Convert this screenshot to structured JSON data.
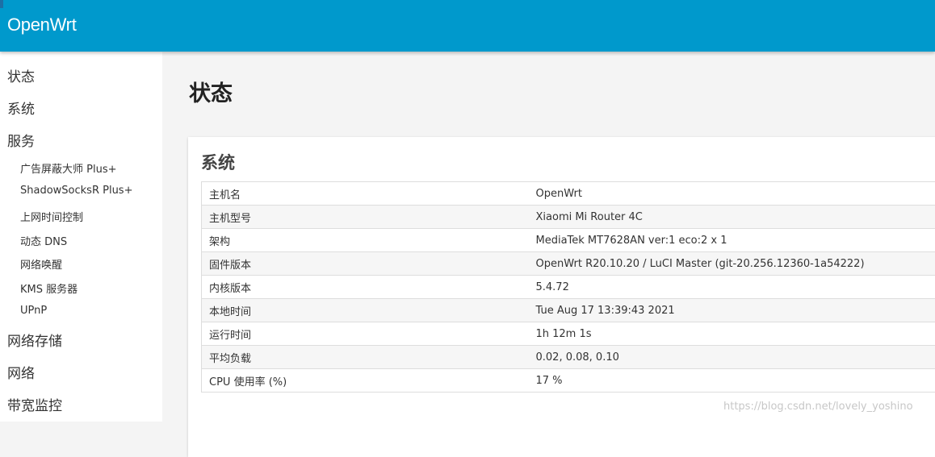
{
  "brand": "OpenWrt",
  "sidebar": {
    "top_items": [
      "状态",
      "系统",
      "服务"
    ],
    "services_subitems": [
      "广告屏蔽大师 Plus+",
      "ShadowSocksR Plus+",
      "上网时间控制",
      "动态 DNS",
      "网络唤醒",
      "KMS 服务器",
      "UPnP"
    ],
    "bottom_items": [
      "网络存储",
      "网络",
      "带宽监控"
    ]
  },
  "page": {
    "title": "状态"
  },
  "system_card": {
    "title": "系统",
    "rows": [
      {
        "label": "主机名",
        "value": "OpenWrt"
      },
      {
        "label": "主机型号",
        "value": "Xiaomi Mi Router 4C"
      },
      {
        "label": "架构",
        "value": "MediaTek MT7628AN ver:1 eco:2 x 1"
      },
      {
        "label": "固件版本",
        "value": "OpenWrt R20.10.20 / LuCI Master (git-20.256.12360-1a54222)"
      },
      {
        "label": "内核版本",
        "value": "5.4.72"
      },
      {
        "label": "本地时间",
        "value": "Tue Aug 17 13:39:43 2021"
      },
      {
        "label": "运行时间",
        "value": "1h 12m 1s"
      },
      {
        "label": "平均负载",
        "value": "0.02, 0.08, 0.10"
      },
      {
        "label": "CPU 使用率 (%)",
        "value": "17 %"
      }
    ]
  },
  "watermark": "https://blog.csdn.net/lovely_yoshino",
  "colors": {
    "header": "#0099cc",
    "sidebar_bg": "#ffffff",
    "main_bg": "#f4f4f4"
  }
}
